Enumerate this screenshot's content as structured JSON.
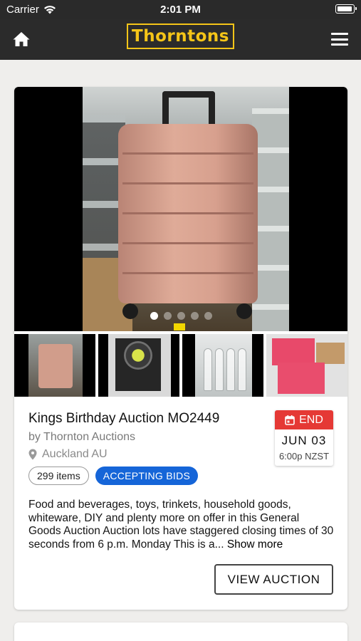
{
  "status_bar": {
    "carrier": "Carrier",
    "time": "2:01 PM"
  },
  "navbar": {
    "logo": "Thorntons",
    "home_icon": "home-icon",
    "menu_icon": "hamburger-menu-icon"
  },
  "auction": {
    "title": "Kings Birthday Auction MO2449",
    "byline": "by Thornton Auctions",
    "location": "Auckland AU",
    "items_badge": "299 items",
    "status_badge": "ACCEPTING BIDS",
    "end_label": "END",
    "end_date": "JUN 03",
    "end_time": "6:00p NZST",
    "description": "Food and beverages, toys, trinkets, household goods, whiteware, DIY and plenty more on offer in this General Goods Auction Auction lots have staggered closing times of 30 seconds from 6 p.m. Monday This is a...",
    "show_more": "Show more",
    "view_button": "VIEW AUCTION",
    "carousel": {
      "total_slides": 5,
      "active_slide": 1
    },
    "thumbnails": [
      "suitcase",
      "speaker",
      "glass-bottles",
      "pink-boxes"
    ]
  },
  "colors": {
    "brand_yellow": "#f5c518",
    "nav_bg": "#2b2b2b",
    "end_red": "#e53935",
    "status_blue": "#1565d8"
  }
}
